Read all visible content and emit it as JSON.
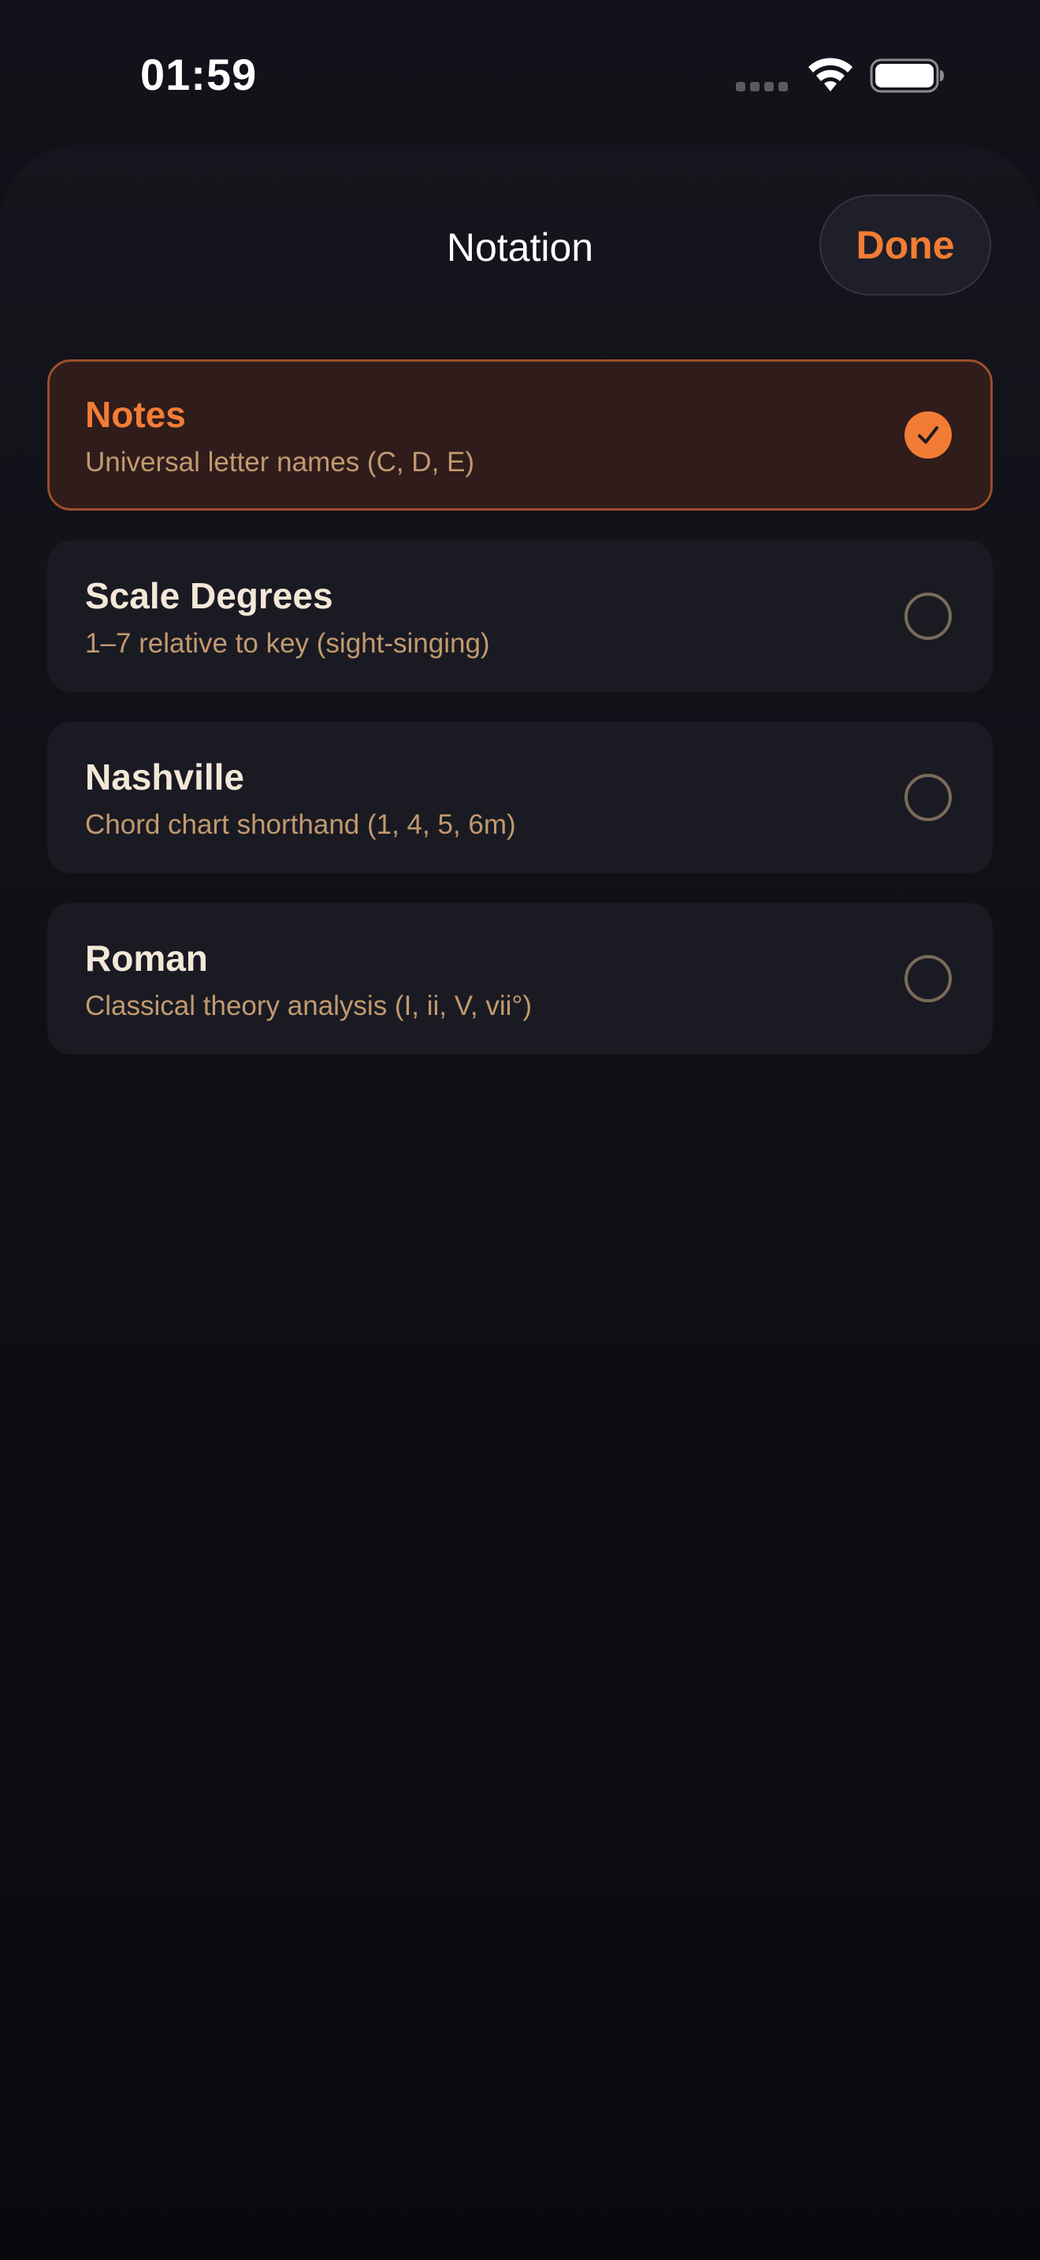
{
  "status_bar": {
    "time": "01:59"
  },
  "header": {
    "title": "Notation",
    "done_label": "Done"
  },
  "colors": {
    "accent": "#f27c35",
    "selected_card_bg": "#2f1c1b",
    "card_bg": "#1a1a23",
    "subtitle": "#c29a6e"
  },
  "options": [
    {
      "title": "Notes",
      "subtitle": "Universal letter names (C, D, E)",
      "selected": true
    },
    {
      "title": "Scale Degrees",
      "subtitle": "1–7 relative to key (sight-singing)",
      "selected": false
    },
    {
      "title": "Nashville",
      "subtitle": "Chord chart shorthand (1, 4, 5, 6m)",
      "selected": false
    },
    {
      "title": "Roman",
      "subtitle": "Classical theory analysis (I, ii, V, vii°)",
      "selected": false
    }
  ]
}
